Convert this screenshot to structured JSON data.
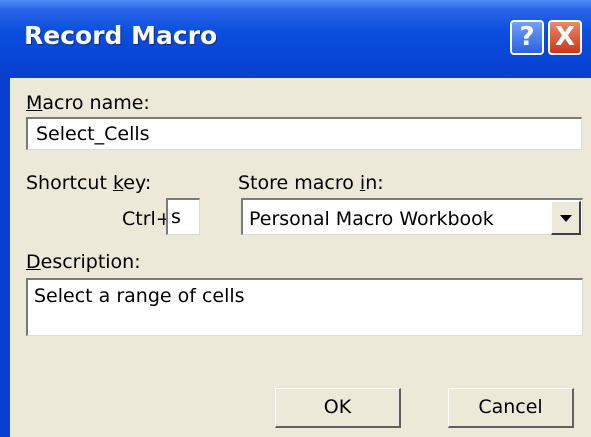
{
  "window": {
    "title": "Record Macro",
    "help_glyph": "?",
    "close_glyph": "X"
  },
  "macro_name": {
    "label_pre": "",
    "label_ul": "M",
    "label_post": "acro name:",
    "value": "Select_Cells"
  },
  "shortcut": {
    "label_pre": "Shortcut ",
    "label_ul": "k",
    "label_post": "ey:",
    "prefix": "Ctrl+",
    "value": "s"
  },
  "store": {
    "label_pre": "Store macro ",
    "label_ul": "i",
    "label_post": "n:",
    "selected": "Personal Macro Workbook"
  },
  "description": {
    "label_pre": "",
    "label_ul": "D",
    "label_post": "escription:",
    "value": "Select a range of cells"
  },
  "buttons": {
    "ok": "OK",
    "cancel": "Cancel"
  },
  "colors": {
    "titlebar": "#0a4fdf",
    "dialog_bg": "#ece9d8",
    "field_border": "#7f9db9"
  }
}
